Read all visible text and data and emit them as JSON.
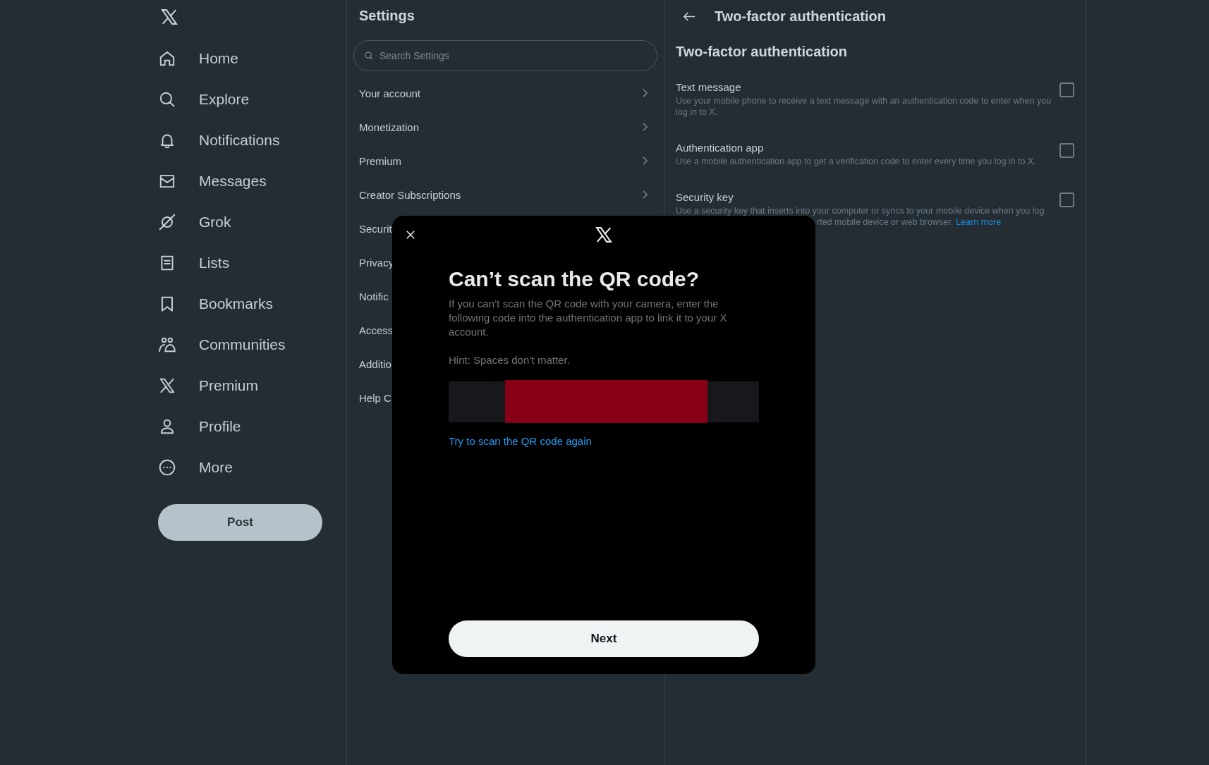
{
  "sidebar": {
    "items": [
      {
        "label": "Home"
      },
      {
        "label": "Explore"
      },
      {
        "label": "Notifications"
      },
      {
        "label": "Messages"
      },
      {
        "label": "Grok"
      },
      {
        "label": "Lists"
      },
      {
        "label": "Bookmarks"
      },
      {
        "label": "Communities"
      },
      {
        "label": "Premium"
      },
      {
        "label": "Profile"
      },
      {
        "label": "More"
      }
    ],
    "post_button": "Post"
  },
  "settings": {
    "title": "Settings",
    "search": {
      "placeholder": "Search Settings"
    },
    "items": [
      {
        "label": "Your account",
        "chevron": true
      },
      {
        "label": "Monetization",
        "chevron": true
      },
      {
        "label": "Premium",
        "chevron": true
      },
      {
        "label": "Creator Subscriptions",
        "chevron": true
      },
      {
        "label": "Securit"
      },
      {
        "label": "Privacy"
      },
      {
        "label": "Notific"
      },
      {
        "label": "Access"
      },
      {
        "label": "Additio"
      },
      {
        "label": "Help C"
      }
    ]
  },
  "detail": {
    "title": "Two-factor authentication",
    "heading": "Two-factor authentication",
    "options": [
      {
        "label": "Text message",
        "description": "Use your mobile phone to receive a text message with an authentication code to enter when you log in to X.",
        "checked": false
      },
      {
        "label": "Authentication app",
        "description": "Use a mobile authentication app to get a verification code to enter every time you log in to X.",
        "checked": false
      },
      {
        "label": "Security key",
        "description": "Use a security key that inserts into your computer or syncs to your mobile device when you log",
        "description_continued": "rted mobile device or web browser.",
        "link": "Learn more",
        "checked": false
      }
    ]
  },
  "dialog": {
    "title": "Can’t scan the QR code?",
    "body": "If you can’t scan the QR code with your camera, enter the following code into the authentication app to link it to your X account.",
    "hint": "Hint: Spaces don’t matter.",
    "code": {
      "redacted": true
    },
    "link": "Try to scan the QR code again",
    "button": "Next"
  }
}
